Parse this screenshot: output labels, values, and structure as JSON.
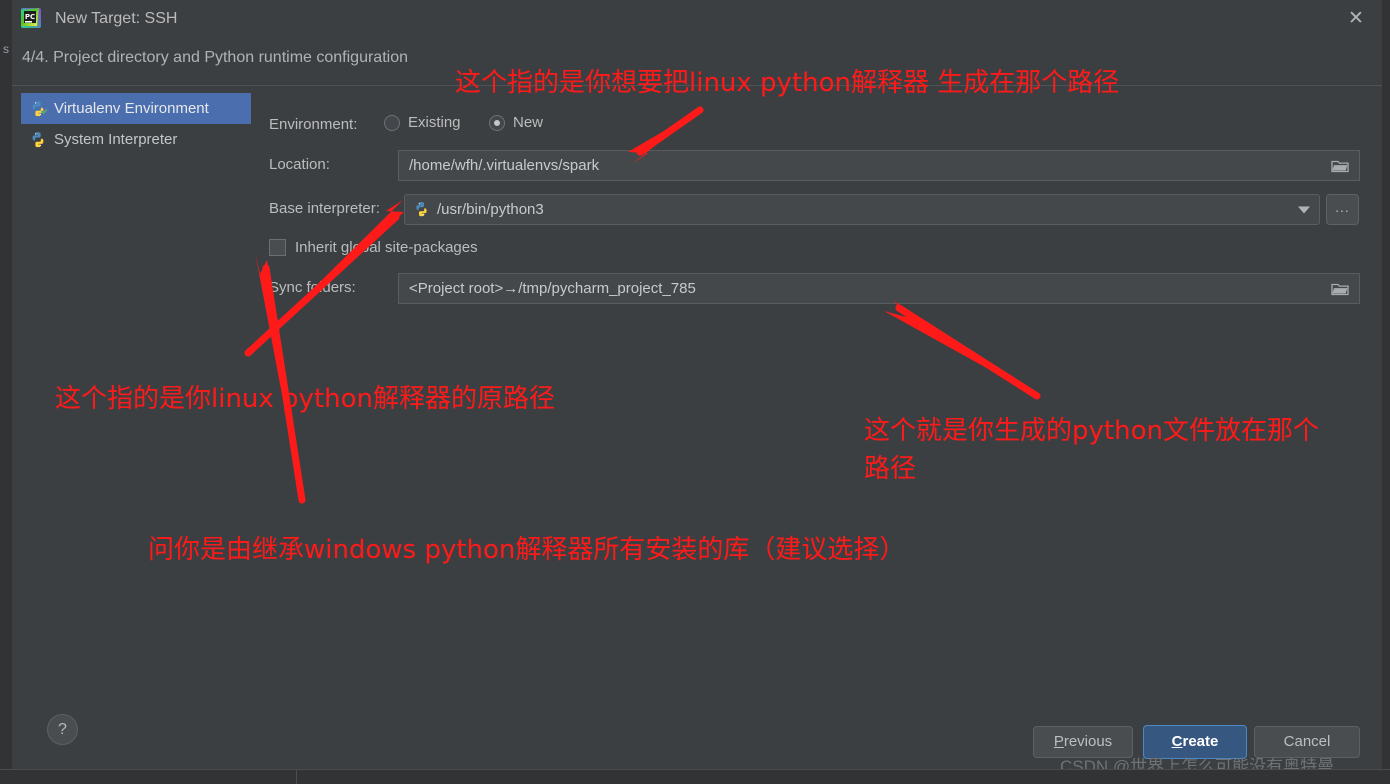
{
  "window": {
    "title": "New Target: SSH",
    "app_icon": "pycharm-icon",
    "close_label": "✕",
    "step_text": "4/4. Project directory and Python runtime configuration"
  },
  "sidebar": {
    "items": [
      {
        "label": "Virtualenv Environment",
        "icon": "python-venv-icon",
        "selected": true
      },
      {
        "label": "System Interpreter",
        "icon": "python-icon",
        "selected": false
      }
    ]
  },
  "form": {
    "environment": {
      "label": "Environment:",
      "options": [
        {
          "label": "Existing",
          "selected": false
        },
        {
          "label": "New",
          "selected": true
        }
      ]
    },
    "location": {
      "label": "Location:",
      "value": "/home/wfh/.virtualenvs/spark",
      "browse_icon": "folder-icon"
    },
    "base_interpreter": {
      "label": "Base interpreter:",
      "value": "/usr/bin/python3",
      "item_icon": "python-icon",
      "dropdown_icon": "chevron-down-icon",
      "more_button_label": "..."
    },
    "inherit": {
      "label": "Inherit global site-packages",
      "checked": false
    },
    "sync_folders": {
      "label": "Sync folders:",
      "value": "<Project root>→/tmp/pycharm_project_785",
      "browse_icon": "folder-icon"
    }
  },
  "footer": {
    "help_label": "?",
    "previous": {
      "prefix": "P",
      "rest": "revious"
    },
    "create": {
      "prefix": "C",
      "rest": "reate"
    },
    "cancel": {
      "label": "Cancel"
    }
  },
  "annotations": [
    {
      "id": "anno-location",
      "text": "这个指的是你想要把linux python解释器 生成在那个路径"
    },
    {
      "id": "anno-base-interpreter",
      "text": "这个指的是你linux python解释器的原路径"
    },
    {
      "id": "anno-sync-folders",
      "text": "这个就是你生成的python文件放在那个路径"
    },
    {
      "id": "anno-inherit",
      "text": "问你是由继承windows python解释器所有安装的库（建议选择）"
    }
  ],
  "watermark": {
    "text": "CSDN @世界上怎么可能没有奥特曼"
  },
  "background": {
    "left_glyph": "s"
  },
  "colors": {
    "dialog_bg": "#3c3f41",
    "field_bg": "#45484a",
    "selection_blue": "#4b6eaf",
    "primary_button": "#365880",
    "annotation_red": "#ff1a1a",
    "text": "#bbbcbd"
  }
}
